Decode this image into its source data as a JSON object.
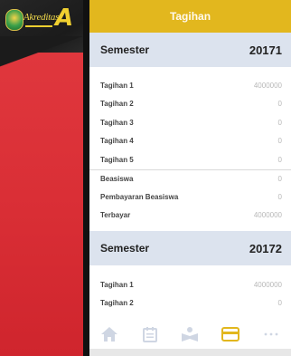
{
  "brand": {
    "logo_text": "Akreditasi",
    "logo_letter": "A"
  },
  "header": {
    "title": "Tagihan"
  },
  "semesters": [
    {
      "label": "Semester",
      "code": "20171",
      "rows": [
        {
          "label": "Tagihan 1",
          "value": "4000000"
        },
        {
          "label": "Tagihan 2",
          "value": "0"
        },
        {
          "label": "Tagihan 3",
          "value": "0"
        },
        {
          "label": "Tagihan 4",
          "value": "0"
        },
        {
          "label": "Tagihan 5",
          "value": "0"
        },
        {
          "label": "Beasiswa",
          "value": "0"
        },
        {
          "label": "Pembayaran Beasiswa",
          "value": "0"
        },
        {
          "label": "Terbayar",
          "value": "4000000"
        }
      ]
    },
    {
      "label": "Semester",
      "code": "20172",
      "rows": [
        {
          "label": "Tagihan 1",
          "value": "4000000"
        },
        {
          "label": "Tagihan 2",
          "value": "0"
        }
      ]
    }
  ],
  "nav": {
    "items": [
      "home-icon",
      "calendar-icon",
      "student-icon",
      "card-icon",
      "more-icon"
    ],
    "active": "card-icon",
    "active_color": "#e2b71e",
    "inactive_color": "#cfd6e3"
  }
}
